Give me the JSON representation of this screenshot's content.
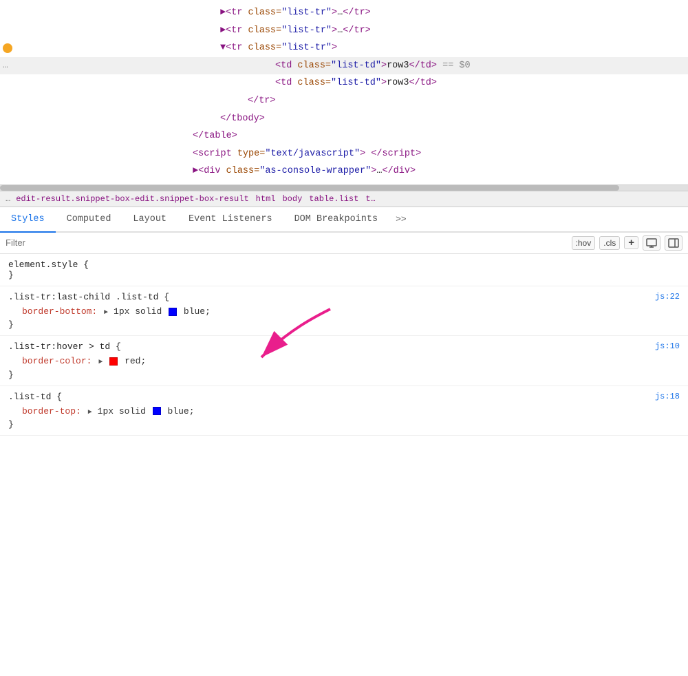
{
  "htmlPanel": {
    "lines": [
      {
        "id": "line1",
        "indent": 240,
        "gutter": "arrow",
        "content_html": "<span class='tag'>&#9658;&lt;tr</span> <span class='attr-name'>class=</span><span class='attr-value'>\"list-tr\"</span><span class='tag'>&gt;</span><span class='text-content'>…</span><span class='tag'>&lt;/tr&gt;</span>"
      },
      {
        "id": "line2",
        "indent": 240,
        "gutter": "",
        "content_html": "<span class='tag'>&#9658;&lt;tr</span> <span class='attr-name'>class=</span><span class='attr-value'>\"list-tr\"</span><span class='tag'>&gt;</span><span class='text-content'>…</span><span class='tag'>&lt;/tr&gt;</span>"
      },
      {
        "id": "line3",
        "indent": 240,
        "gutter": "dot",
        "content_html": "<span class='tag'>&#9660;&lt;tr</span> <span class='attr-name'>class=</span><span class='attr-value'>\"list-tr\"</span><span class='tag'>&gt;</span>"
      },
      {
        "id": "line4",
        "indent": 320,
        "gutter": "dots",
        "highlighted": true,
        "content_html": "<span class='tag'>&lt;td</span> <span class='attr-name'>class=</span><span class='attr-value'>\"list-td\"</span><span class='tag'>&gt;</span><span class='text-content'>row3</span><span class='tag'>&lt;/td&gt;</span> <span class='equals-marker'>== $0</span>"
      },
      {
        "id": "line5",
        "indent": 320,
        "gutter": "",
        "content_html": "<span class='tag'>&lt;td</span> <span class='attr-name'>class=</span><span class='attr-value'>\"list-td\"</span><span class='tag'>&gt;</span><span class='text-content'>row3</span><span class='tag'>&lt;/td&gt;</span>"
      },
      {
        "id": "line6",
        "indent": 280,
        "gutter": "",
        "content_html": "<span class='tag'>&lt;/tr&gt;</span>"
      },
      {
        "id": "line7",
        "indent": 240,
        "gutter": "",
        "content_html": "<span class='tag'>&lt;/tbody&gt;</span>"
      },
      {
        "id": "line8",
        "indent": 200,
        "gutter": "",
        "content_html": "<span class='tag'>&lt;/table&gt;</span>"
      },
      {
        "id": "line9",
        "indent": 200,
        "gutter": "",
        "content_html": "<span class='tag'>&lt;script</span> <span class='attr-name'>type=</span><span class='attr-value'>\"text/javascript\"</span><span class='tag'>&gt;</span> <span class='tag'>&lt;/script&gt;</span>"
      },
      {
        "id": "line10",
        "indent": 200,
        "gutter": "",
        "content_html": "<span class='tag'>&#9658;&lt;div</span> <span class='attr-name'>class=</span><span class='attr-value'>\"as-console-wrapper\"</span><span class='tag'>&gt;</span><span class='text-content'>…</span><span class='tag'>&lt;/div&gt;</span>"
      }
    ]
  },
  "breadcrumb": {
    "dots": "...",
    "items": [
      {
        "text": "edit-result.snippet-box-edit.snippet-box-result",
        "color": "#881280"
      },
      {
        "text": "html",
        "color": "#881280"
      },
      {
        "text": "body",
        "color": "#881280"
      },
      {
        "text": "table.list",
        "color": "#881280"
      },
      {
        "text": "t…",
        "color": "#881280"
      }
    ]
  },
  "tabs": {
    "items": [
      {
        "label": "Styles",
        "active": true
      },
      {
        "label": "Computed",
        "active": false
      },
      {
        "label": "Layout",
        "active": false
      },
      {
        "label": "Event Listeners",
        "active": false
      },
      {
        "label": "DOM Breakpoints",
        "active": false
      },
      {
        "label": ">>",
        "active": false
      }
    ]
  },
  "filterBar": {
    "placeholder": "Filter",
    "buttons": [
      {
        "label": ":hov"
      },
      {
        "label": ".cls"
      },
      {
        "label": "+"
      }
    ],
    "icons": [
      "monitor-icon",
      "sidebar-icon"
    ]
  },
  "cssRules": [
    {
      "id": "element-style",
      "selector": "element.style {",
      "close": "}",
      "properties": [],
      "source": ""
    },
    {
      "id": "rule1",
      "selector": ".list-tr:last-child .list-td {",
      "close": "}",
      "source": "js:22",
      "properties": [
        {
          "name": "border-bottom:",
          "triangle": true,
          "value": "1px solid",
          "color": "#0000ff",
          "colorLabel": "blue",
          "suffix": ";"
        }
      ]
    },
    {
      "id": "rule2",
      "selector": ".list-tr:hover > td {",
      "close": "}",
      "source": "js:10",
      "properties": [
        {
          "name": "border-color:",
          "triangle": true,
          "value": "",
          "color": "#ff0000",
          "colorLabel": "red",
          "suffix": ";"
        }
      ]
    },
    {
      "id": "rule3",
      "selector": ".list-td {",
      "close": "}",
      "source": "js:18",
      "properties": [
        {
          "name": "border-top:",
          "triangle": true,
          "value": "1px solid",
          "color": "#0000ff",
          "colorLabel": "blue",
          "suffix": ";"
        }
      ]
    }
  ],
  "arrow": {
    "label": "pink arrow pointing to css rule area"
  }
}
